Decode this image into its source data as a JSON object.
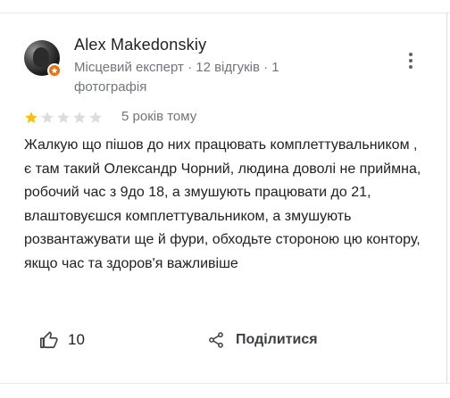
{
  "review": {
    "author": {
      "name": "Alex Makedonskiy",
      "meta": "Місцевий експерт · 12 відгуків · 1 фотографія",
      "avatar_icon": "profile-photo",
      "badge_icon": "local-guide-badge-icon",
      "badge_color": "#e8710a"
    },
    "rating": {
      "value": 1,
      "max": 5,
      "filled_color": "#fbbc04",
      "empty_color": "#dadce0"
    },
    "time": "5 років тому",
    "text": "Жалкую що пішов до них працювать комплеттувальником , є там такий Олександр Чорний, людина доволі не приймна, робочий час з 9до 18, а змушують працювати до 21, влаштовуєшся комплеттувальником, а змушують розвантажувати ще й фури, обходьте стороною цю контору, якщо час та здоров'я важливіше",
    "actions": {
      "like_icon": "thumbs-up-icon",
      "like_count": "10",
      "share_icon": "share-icon",
      "share_label": "Поділитися"
    },
    "menu_icon": "more-vert-icon"
  }
}
